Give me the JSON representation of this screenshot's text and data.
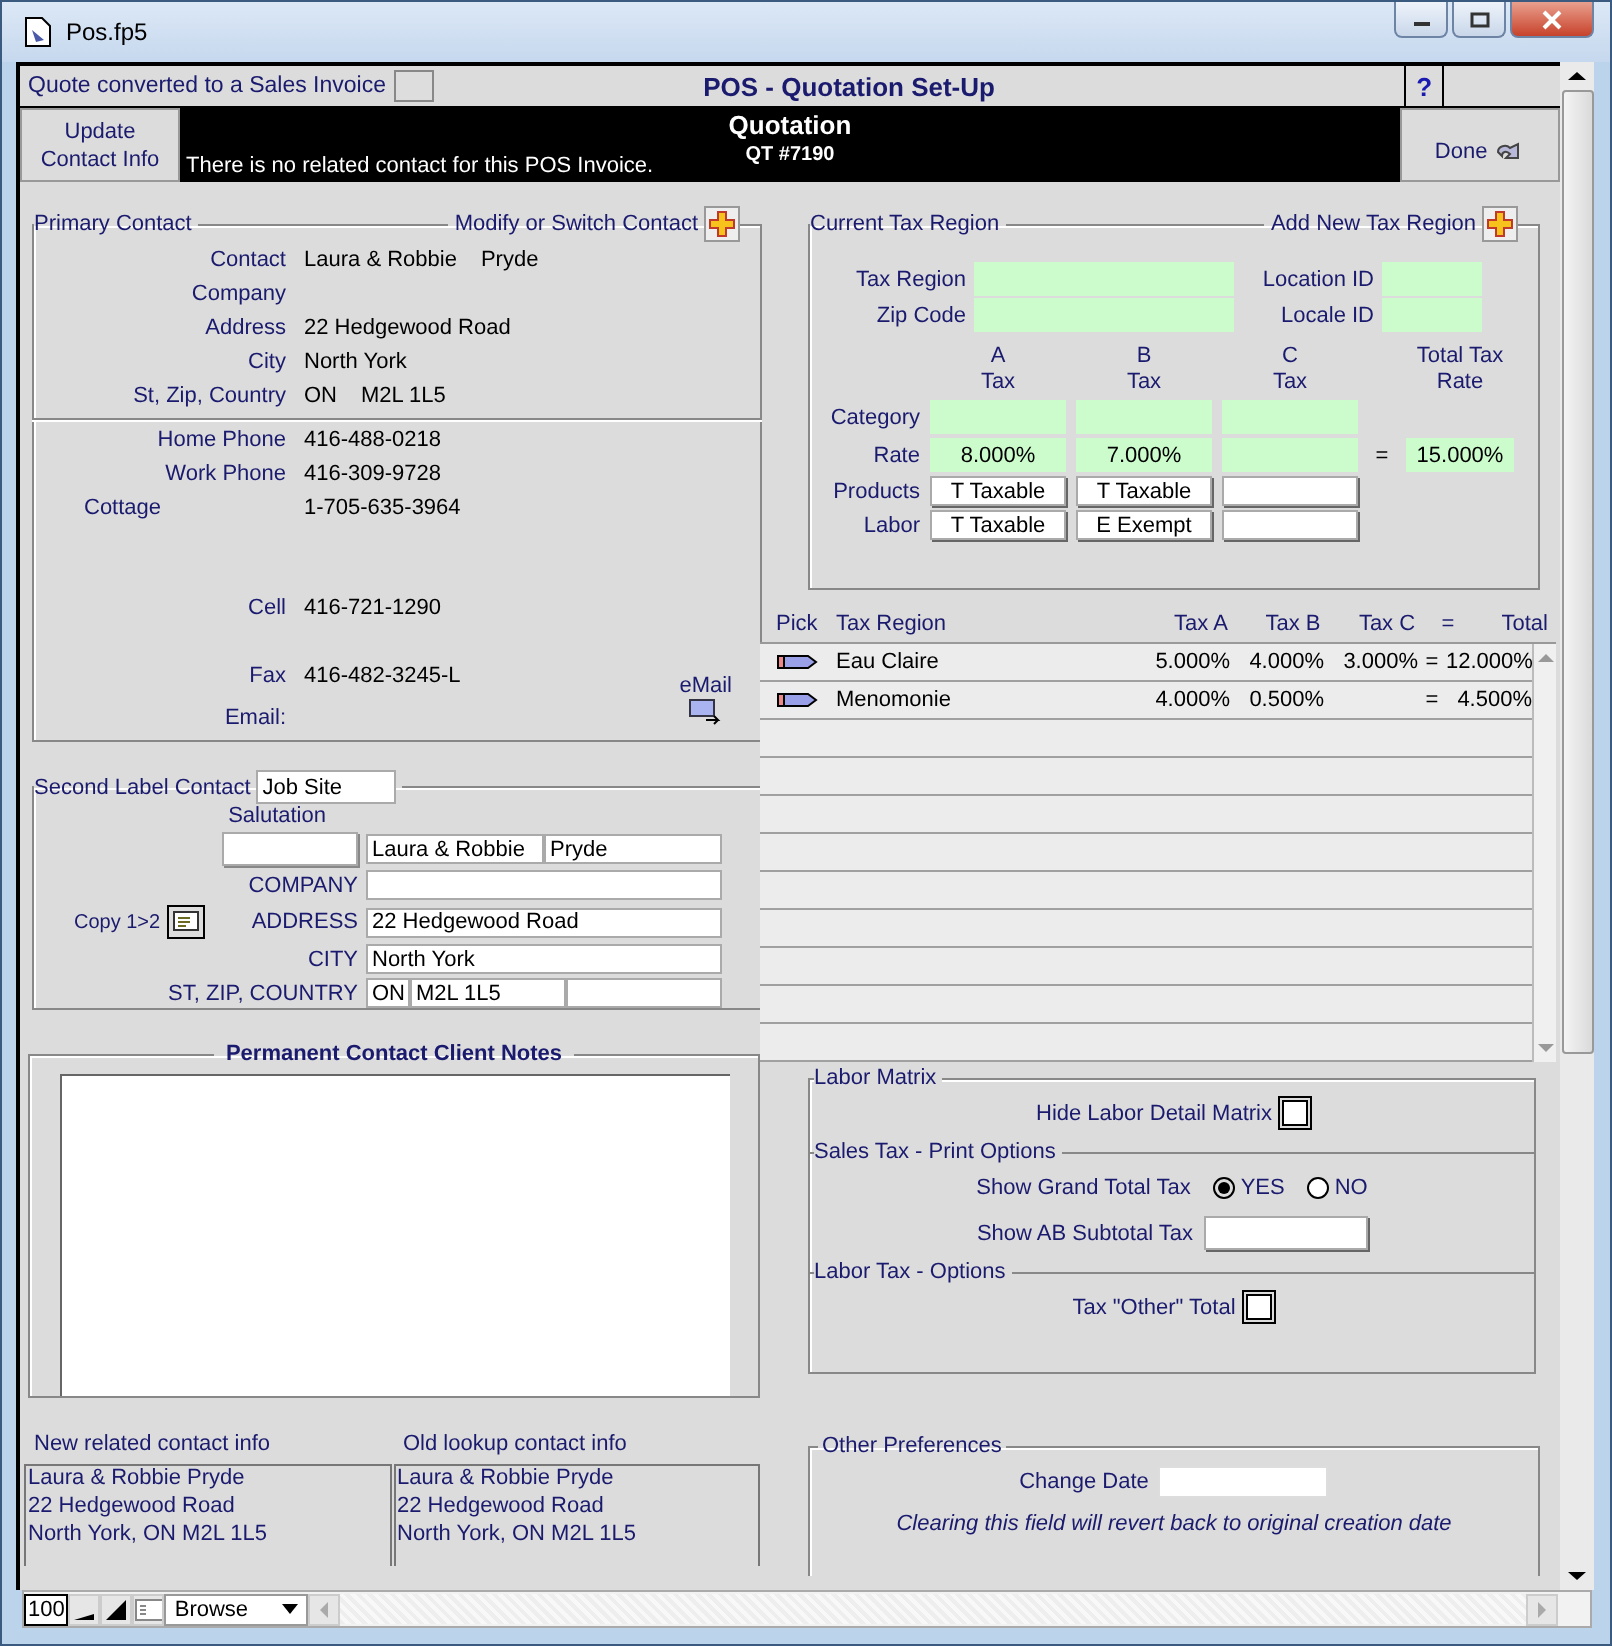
{
  "window": {
    "title": "Pos.fp5"
  },
  "header": {
    "converted_label": "Quote converted to a Sales Invoice",
    "converted_checked": false,
    "title": "POS - Quotation Set-Up",
    "help": "?"
  },
  "banner": {
    "update_button": "Update Contact Info",
    "message": "There is no related contact for this POS Invoice.",
    "heading": "Quotation",
    "number": "QT #7190",
    "done_button": "Done"
  },
  "primary_contact": {
    "title": "Primary Contact",
    "action": "Modify or Switch Contact",
    "fields": [
      {
        "label": "Contact",
        "values": [
          "Laura & Robbie",
          "Pryde"
        ]
      },
      {
        "label": "Company"
      },
      {
        "label": "Address",
        "values": [
          "22 Hedgewood Road"
        ]
      },
      {
        "label": "City",
        "values": [
          "North York"
        ]
      },
      {
        "label": "St, Zip, Country",
        "values": [
          "ON",
          "M2L 1L5"
        ]
      }
    ],
    "phones": [
      {
        "kind": "standard",
        "label": "Home Phone",
        "value": "416-488-0218"
      },
      {
        "kind": "standard",
        "label": "Work Phone",
        "value": "416-309-9728"
      },
      {
        "kind": "indented",
        "label": "Cottage",
        "value": "1-705-635-3964"
      },
      {
        "kind": "standard",
        "label": "Cell",
        "value": "416-721-1290"
      },
      {
        "kind": "standard",
        "label": "Fax",
        "value": "416-482-3245-L"
      }
    ],
    "email": {
      "label": "Email:",
      "link": "eMail"
    }
  },
  "second_contact": {
    "title": "Second Label Contact",
    "label_value": "Job Site",
    "salutation_label": "Salutation",
    "name": [
      "Laura & Robbie",
      "Pryde"
    ],
    "copy_button": "Copy 1>2",
    "fields": [
      {
        "kind": "single",
        "label": "COMPANY"
      },
      {
        "kind": "single",
        "label": "ADDRESS",
        "value": "22 Hedgewood Road"
      },
      {
        "kind": "single",
        "label": "CITY",
        "value": "North York"
      },
      {
        "kind": "triple",
        "label": "ST, ZIP, COUNTRY",
        "state": "ON",
        "zip": "M2L 1L5"
      }
    ]
  },
  "notes": {
    "title": "Permanent Contact Client Notes"
  },
  "related": [
    {
      "label": "New related contact info",
      "lines": [
        "Laura & Robbie Pryde",
        "22 Hedgewood Road",
        "North York, ON M2L 1L5"
      ]
    },
    {
      "label": "Old lookup contact info",
      "lines": [
        "Laura & Robbie Pryde",
        "22 Hedgewood Road",
        "North York, ON M2L 1L5"
      ]
    }
  ],
  "tax_region": {
    "title": "Current Tax Region",
    "action": "Add New Tax Region",
    "fields": [
      {
        "label": "Tax Region"
      },
      {
        "label": "Location ID"
      },
      {
        "label": "Zip Code"
      },
      {
        "label": "Locale ID"
      }
    ],
    "columns": [
      "A Tax",
      "B Tax",
      "C Tax"
    ],
    "total_heading": "Total Tax Rate",
    "rows": [
      {
        "kind": "green",
        "label": "Category"
      },
      {
        "kind": "green",
        "label": "Rate",
        "a": "8.000%",
        "b": "7.000%",
        "equals": "=",
        "total": "15.000%"
      },
      {
        "kind": "white",
        "label": "Products",
        "a": "T Taxable",
        "b": "T Taxable"
      },
      {
        "kind": "white",
        "label": "Labor",
        "a": "T Taxable",
        "b": "E Exempt"
      }
    ]
  },
  "tax_table": {
    "columns": [
      "Pick",
      "Tax Region",
      "Tax A",
      "Tax B",
      "Tax C",
      "=",
      "Total"
    ],
    "rows": [
      {
        "region": "Eau Claire",
        "tax_a": "5.000%",
        "tax_b": "4.000%",
        "tax_c": "3.000%",
        "equals": "=",
        "total": "12.000%"
      },
      {
        "region": "Menomonie",
        "tax_a": "4.000%",
        "tax_b": "0.500%",
        "equals": "=",
        "total": "4.500%"
      }
    ]
  },
  "options": [
    {
      "title": "Labor Matrix",
      "items": [
        {
          "kind": "checkbox",
          "label": "Hide Labor Detail Matrix",
          "checked": false
        }
      ]
    },
    {
      "title": "Sales Tax - Print Options",
      "items": [
        {
          "kind": "radio",
          "label": "Show Grand Total Tax",
          "options": [
            {
              "label": "YES",
              "selected": true
            },
            {
              "label": "NO",
              "selected": false
            }
          ]
        },
        {
          "kind": "field",
          "label": "Show AB Subtotal Tax"
        }
      ]
    },
    {
      "title": "Labor Tax  - Options",
      "items": [
        {
          "kind": "checkbox",
          "label": "Tax \"Other\" Total",
          "checked": false
        }
      ]
    }
  ],
  "other_preferences": {
    "title": "Other Preferences",
    "field_label": "Change Date",
    "note": "Clearing this field will revert back to original creation date"
  },
  "status_bar": {
    "zoom": "100",
    "mode": "Browse"
  }
}
